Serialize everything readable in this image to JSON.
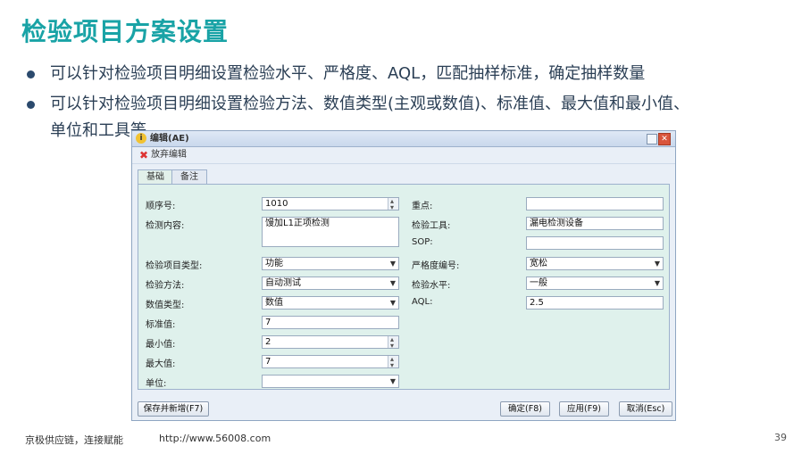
{
  "slide": {
    "title": "检验项目方案设置",
    "bullets": [
      "可以针对检验项目明细设置检验水平、严格度、AQL，匹配抽样标准，确定抽样数量",
      "可以针对检验项目明细设置检验方法、数值类型(主观或数值)、标准值、最大值和最小值、单位和工具等"
    ],
    "footer_left": "京极供应链，连接赋能",
    "footer_url": "http://www.56008.com",
    "page_number": "39"
  },
  "dialog": {
    "title": "编辑(AE)",
    "toolbar": {
      "discard_label": "放弃编辑"
    },
    "tabs": [
      {
        "label": "基础"
      },
      {
        "label": "备注"
      }
    ],
    "left": {
      "seq_label": "顺序号:",
      "seq_value": "1010",
      "content_label": "检测内容:",
      "content_value": "馒加L1正项检测",
      "type_label": "检验项目类型:",
      "type_value": "功能",
      "method_label": "检验方法:",
      "method_value": "自动测试",
      "datatype_label": "数值类型:",
      "datatype_value": "数值",
      "std_label": "标准值:",
      "std_value": "7",
      "min_label": "最小值:",
      "min_value": "2",
      "max_label": "最大值:",
      "max_value": "7",
      "unit_label": "单位:",
      "unit_value": ""
    },
    "right": {
      "key_label": "重点:",
      "key_value": "",
      "tool_label": "检验工具:",
      "tool_value": "漏电检测设备",
      "sop_label": "SOP:",
      "sop_value": "",
      "severity_label": "严格度编号:",
      "severity_value": "宽松",
      "level_label": "检验水平:",
      "level_value": "一般",
      "aql_label": "AQL:",
      "aql_value": "2.5"
    },
    "buttons": {
      "save_new": "保存并新增(F7)",
      "ok": "确定(F8)",
      "apply": "应用(F9)",
      "cancel": "取消(Esc)"
    }
  }
}
